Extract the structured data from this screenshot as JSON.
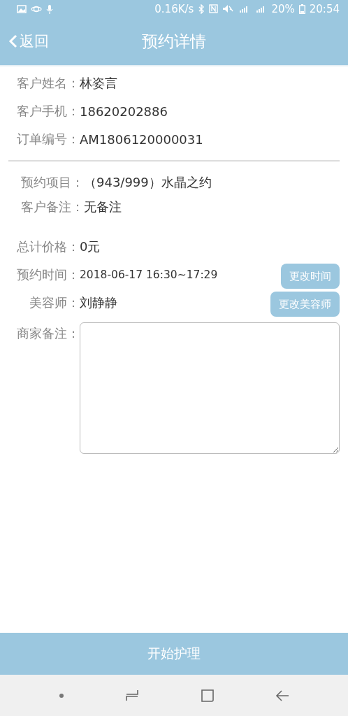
{
  "status_bar": {
    "net_speed": "0.16K/s",
    "battery": "20%",
    "time": "20:54"
  },
  "header": {
    "back": "返回",
    "title": "预约详情"
  },
  "sections": [
    {
      "divided": true,
      "indent": false,
      "fields": [
        {
          "kind": "text",
          "label": "客户姓名：",
          "value": "林姿言"
        },
        {
          "kind": "text",
          "label": "客户手机：",
          "value": "18620202886"
        },
        {
          "kind": "text",
          "label": "订单编号：",
          "value": "AM1806120000031"
        }
      ]
    },
    {
      "divided": false,
      "indent": true,
      "fields": [
        {
          "kind": "text",
          "label": "预约项目：",
          "value": "（943/999）水晶之约"
        },
        {
          "kind": "text",
          "label": "客户备注：",
          "value": "无备注"
        }
      ]
    },
    {
      "divided": false,
      "indent": false,
      "fields": [
        {
          "kind": "text",
          "label": "总计价格：",
          "value": "0元"
        },
        {
          "kind": "small",
          "label": "预约时间：",
          "value": "2018-06-17 16:30~17:29",
          "action": "更改时间"
        },
        {
          "kind": "text",
          "label": "美容师：",
          "value": "刘静静",
          "action": "更改美容师"
        },
        {
          "kind": "textarea",
          "label": "商家备注："
        }
      ]
    }
  ],
  "footer_button": "开始护理"
}
